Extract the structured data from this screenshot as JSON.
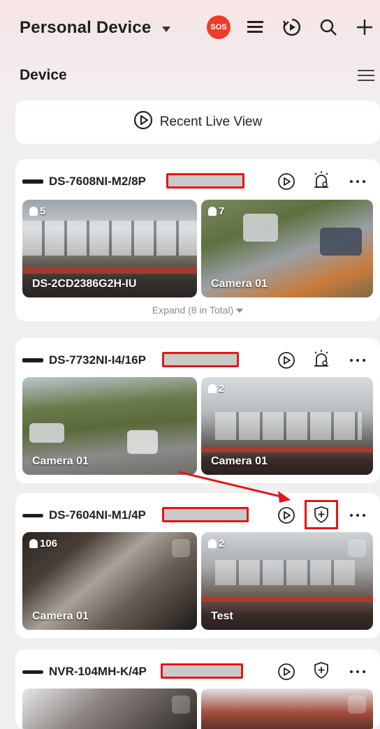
{
  "header": {
    "title": "Personal Device",
    "sos_label": "SOS",
    "icons": [
      "chevron-down-icon",
      "sos-icon",
      "list-icon",
      "playback-icon",
      "search-icon",
      "add-icon"
    ]
  },
  "section": {
    "title": "Device",
    "menu_icon": "hamburger-icon"
  },
  "recent": {
    "label": "Recent Live View"
  },
  "devices": [
    {
      "name": "DS-7608NI-M2/8P",
      "action_icons": [
        "play-icon",
        "alarm-settings-icon",
        "more-icon"
      ],
      "thumbs": [
        {
          "label": "DS-2CD2386G2H-IU",
          "badge": "5"
        },
        {
          "label": "Camera 01",
          "badge": "7"
        }
      ],
      "expand_label": "Expand (8 in Total)"
    },
    {
      "name": "DS-7732NI-I4/16P",
      "action_icons": [
        "play-icon",
        "alarm-settings-icon",
        "more-icon"
      ],
      "thumbs": [
        {
          "label": "Camera 01",
          "badge": ""
        },
        {
          "label": "Camera 01",
          "badge": "2"
        }
      ]
    },
    {
      "name": "DS-7604NI-M1/4P",
      "action_icons": [
        "play-icon",
        "shield-add-icon",
        "more-icon"
      ],
      "thumbs": [
        {
          "label": "Camera 01",
          "badge": "106"
        },
        {
          "label": "Test",
          "badge": "2"
        }
      ]
    },
    {
      "name": "NVR-104MH-K/4P",
      "action_icons": [
        "play-icon",
        "shield-add-icon",
        "more-icon"
      ],
      "thumbs": [
        {
          "label": "",
          "badge": ""
        },
        {
          "label": "",
          "badge": ""
        }
      ]
    }
  ],
  "colors": {
    "accent_red": "#e0161a",
    "sos_red": "#f03b2c",
    "card_bg": "#ffffff",
    "page_bg": "#efefef"
  }
}
